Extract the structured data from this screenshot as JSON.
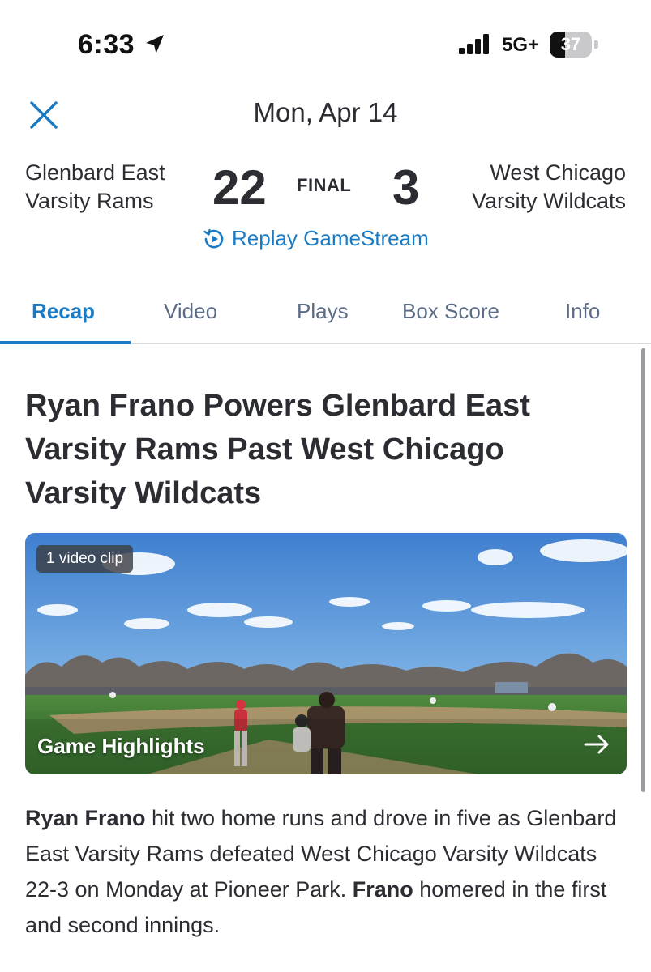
{
  "status_bar": {
    "time": "6:33",
    "network": "5G+",
    "battery": "37",
    "battery_level": 0.37
  },
  "header": {
    "date": "Mon, Apr 14"
  },
  "scoreboard": {
    "home_team_line1": "Glenbard East",
    "home_team_line2": "Varsity Rams",
    "home_score": "22",
    "status": "FINAL",
    "away_score": "3",
    "away_team_line1": "West Chicago",
    "away_team_line2": "Varsity Wildcats",
    "replay_label": "Replay GameStream"
  },
  "tabs": [
    {
      "label": "Recap",
      "active": true
    },
    {
      "label": "Video",
      "active": false
    },
    {
      "label": "Plays",
      "active": false
    },
    {
      "label": "Box Score",
      "active": false
    },
    {
      "label": "Info",
      "active": false
    }
  ],
  "article": {
    "headline": "Ryan Frano Powers Glenbard East Varsity Rams Past West Chicago Varsity Wildcats",
    "video": {
      "badge": "1 video clip",
      "title": "Game Highlights"
    },
    "body": {
      "name1": "Ryan Frano",
      "text1": " hit two home runs and drove in five as Glenbard East Varsity Rams defeated West Chicago Varsity Wildcats 22-3 on Monday at Pioneer Park. ",
      "name2": "Frano",
      "text2": " homered in the first and second innings."
    }
  },
  "colors": {
    "accent": "#1a7bc4",
    "text": "#2b2d33",
    "tab_inactive": "#5b6b86"
  }
}
